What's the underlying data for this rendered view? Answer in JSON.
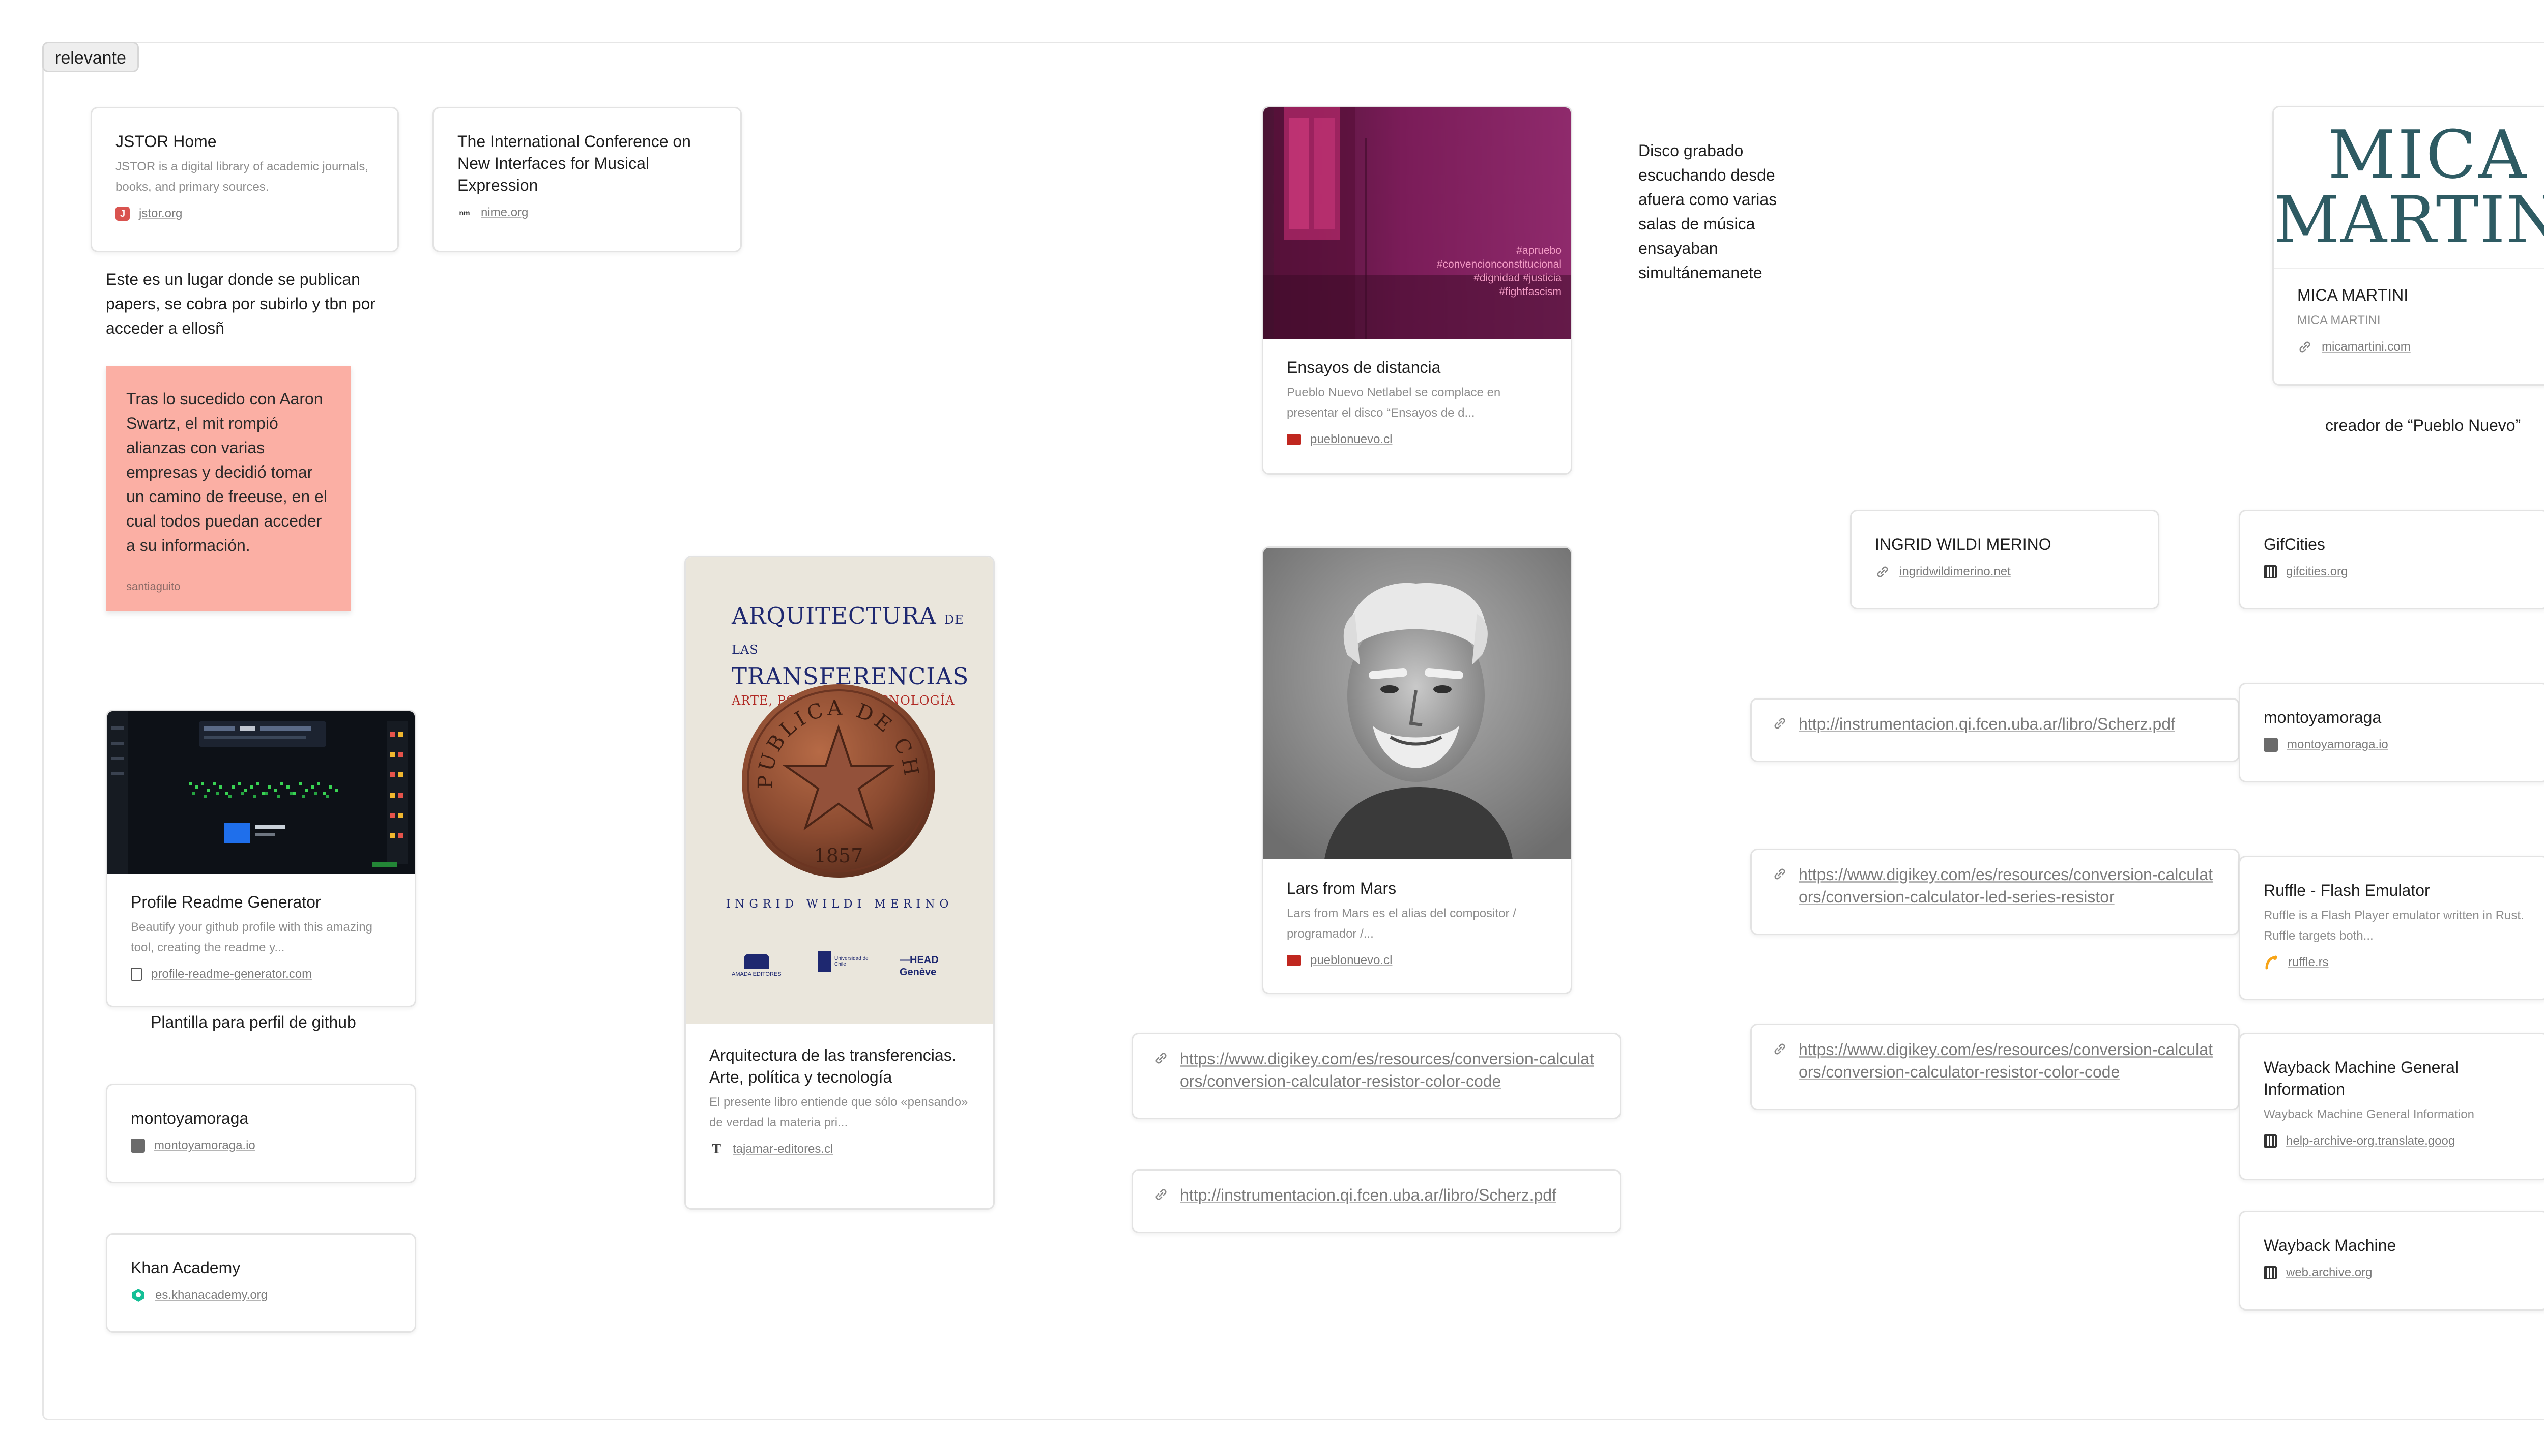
{
  "board": {
    "tag": "relevante"
  },
  "cards": {
    "jstor": {
      "title": "JSTOR Home",
      "desc": "JSTOR is a digital library of academic journals, books, and primary sources.",
      "domain": "jstor.org"
    },
    "nime": {
      "title": "The International Conference on New Interfaces for Musical Expression",
      "domain": "nime.org"
    },
    "ensayos": {
      "title": "Ensayos de distancia",
      "desc": "Pueblo Nuevo Netlabel se complace en presentar el disco “Ensayos de d...",
      "domain": "pueblonuevo.cl",
      "image_hashtags": [
        "#apruebo",
        "#convencionconstitucional",
        "#dignidad #justicia",
        "#fightfascism"
      ]
    },
    "mica": {
      "logo_line1": "MICA",
      "logo_line2": "MARTINI",
      "title": "MICA MARTINI",
      "desc": "MICA MARTINI",
      "domain": "micamartini.com"
    },
    "ingrid": {
      "title": "INGRID WILDI MERINO",
      "domain": "ingridwildimerino.net"
    },
    "gifcities": {
      "title": "GifCities",
      "domain": "gifcities.org"
    },
    "montoya_right": {
      "title": "montoyamoraga",
      "domain": "montoyamoraga.io"
    },
    "ruffle": {
      "title": "Ruffle - Flash Emulator",
      "desc": "Ruffle is a Flash Player emulator written in Rust. Ruffle targets both...",
      "domain": "ruffle.rs"
    },
    "wayback_info": {
      "title": "Wayback Machine General Information",
      "desc": "Wayback Machine General Information",
      "domain": "help-archive-org.translate.goog"
    },
    "wayback": {
      "title": "Wayback Machine",
      "domain": "web.archive.org"
    },
    "profile": {
      "title": "Profile Readme Generator",
      "desc": "Beautify your github profile with this amazing tool, creating the readme y...",
      "domain": "profile-readme-generator.com"
    },
    "montoya_left": {
      "title": "montoyamoraga",
      "domain": "montoyamoraga.io"
    },
    "khan": {
      "title": "Khan Academy",
      "domain": "es.khanacademy.org"
    },
    "arquitectura": {
      "title": "Arquitectura de las transferencias. Arte, política y tecnología",
      "desc": "El presente libro entiende que sólo «pensando» de verdad la materia pri...",
      "domain": "tajamar-editores.cl",
      "cover_title_1": "ARQUITECTURA",
      "cover_title_small": "DE LAS",
      "cover_title_2": "TRANSFERENCIAS",
      "cover_subtitle": "ARTE, POLÍTICA Y TECNOLOGÍA",
      "cover_author": "INGRID WILDI MERINO",
      "coin_text": "REPUBLICA DE CHILE",
      "coin_year": "1857",
      "publisher_1": "AMADA EDITORES",
      "publisher_2": "Universidad de Chile",
      "publisher_3_line1": "HEAD",
      "publisher_3_line2": "Genève"
    },
    "lars": {
      "title": "Lars from Mars",
      "desc": "Lars from Mars es el alias del compositor / programador /...",
      "domain": "pueblonuevo.cl"
    }
  },
  "url_cards": {
    "url_mid_1": "https://www.digikey.com/es/resources/conversion-calculators/conversion-calculator-resistor-color-code",
    "url_mid_2": "http://instrumentacion.qi.fcen.uba.ar/libro/Scherz.pdf",
    "url_right_1": "http://instrumentacion.qi.fcen.uba.ar/libro/Scherz.pdf",
    "url_right_2": "https://www.digikey.com/es/resources/conversion-calculators/conversion-calculator-led-series-resistor",
    "url_right_3": "https://www.digikey.com/es/resources/conversion-calculators/conversion-calculator-resistor-color-code"
  },
  "notes": {
    "jstor_note": "Este es un lugar donde se publican papers, se cobra por subirlo y tbn por acceder a ellosñ",
    "disco_note": "Disco grabado escuchando desde afuera como varias salas de música ensayaban simultánemanete",
    "mica_note": "creador de “Pueblo Nuevo”",
    "profile_note": "Plantilla para perfil de github"
  },
  "sticky": {
    "text": "Tras lo sucedido con Aaron Swartz, el mit rompió alianzas con varias empresas y decidió tomar un camino de freeuse, en el cual todos puedan acceder a su información.",
    "author": "santiaguito"
  },
  "colors": {
    "sticky": "#fbafa4",
    "card_border": "#e3e3e3",
    "text_muted": "#8d8d8d",
    "mica_teal": "#2e5b63",
    "book_navy": "#1e2870",
    "book_red": "#b02a24"
  }
}
